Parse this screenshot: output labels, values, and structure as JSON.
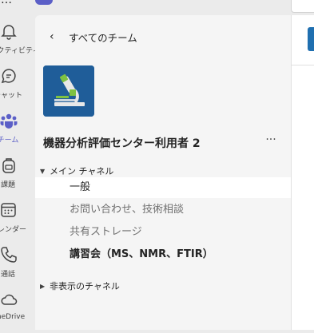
{
  "rail": {
    "items": [
      {
        "label": "アクティビティ"
      },
      {
        "label": "チャット"
      },
      {
        "label": "チーム"
      },
      {
        "label": "課題"
      },
      {
        "label": "カレンダー"
      },
      {
        "label": "通話"
      },
      {
        "label": "OneDrive"
      }
    ]
  },
  "panel": {
    "back_label": "すべてのチーム",
    "team_name": "機器分析評価センター利用者 2",
    "more_label": "···",
    "main_section": "メイン チャネル",
    "channels": [
      {
        "label": "一般"
      },
      {
        "label": "お問い合わせ、技術相談"
      },
      {
        "label": "共有ストレージ"
      },
      {
        "label": "講習会（MS、NMR、FTIR）"
      }
    ],
    "hidden_section": "非表示のチャネル"
  },
  "colors": {
    "accent": "#5b5fc7",
    "team_avatar_bg": "#1f5d99",
    "selected_bg": "#ffffff"
  }
}
